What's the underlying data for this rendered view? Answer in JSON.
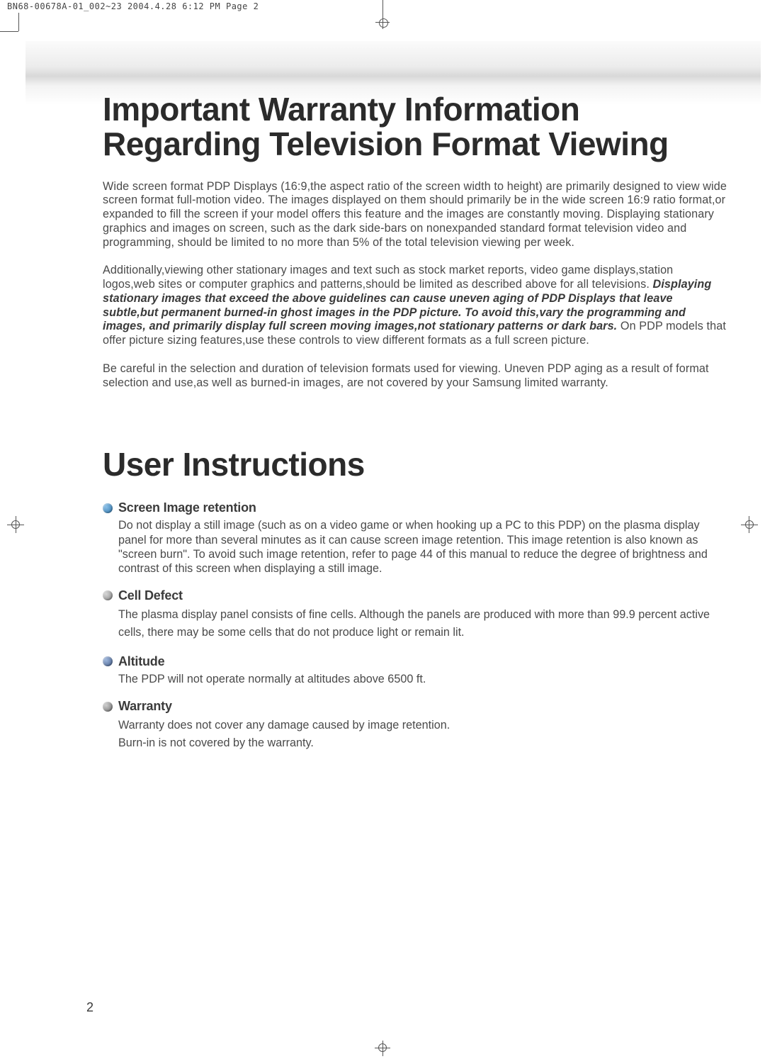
{
  "print_header": "BN68-00678A-01_002~23  2004.4.28  6:12 PM  Page 2",
  "title1": "Important Warranty Information Regarding Television Format Viewing",
  "para1": "Wide screen format PDP Displays (16:9,the aspect ratio of the screen width to height) are primarily designed to view wide screen format full-motion video. The images displayed on them should primarily be in the wide screen 16:9 ratio format,or expanded to fill the screen if your model offers this feature and the images are constantly moving. Displaying stationary graphics and images on screen, such as the dark side-bars on nonexpanded standard format television video and programming, should be limited to no more than 5% of the total television viewing per week.",
  "para2a": "Additionally,viewing other stationary images and text such as stock market reports, video game displays,station logos,web sites or computer graphics and patterns,should be limited as described above for all televisions. ",
  "para2b_bold": "Displaying stationary images that exceed the above guidelines can cause uneven aging of PDP Displays that leave subtle,but permanent burned-in ghost images in the PDP picture. To avoid this,vary the programming and images, and primarily display full screen moving images,not stationary patterns or dark bars.",
  "para2c": " On PDP models that offer picture sizing features,use these controls to view different formats as a full screen picture.",
  "para3": "Be careful in the selection and duration of television formats used for viewing. Uneven PDP aging as a result of format selection and use,as well as burned-in images, are not covered by your Samsung limited warranty.",
  "title2": "User Instructions",
  "sections": [
    {
      "title": "Screen Image retention",
      "body": "Do not display a still image (such as on a video game or when hooking up a PC to this PDP) on the plasma display panel for more than several minutes as  it can cause screen image retention. This image retention is also known as \"screen burn\". To avoid such image retention, refer to page 44 of this manual to reduce the degree of brightness and contrast of this screen when displaying a still image."
    },
    {
      "title": "Cell Defect",
      "body": "The plasma display panel consists of fine cells. Although the panels are produced with more than 99.9 percent active cells, there may be some cells that do not produce light or remain lit."
    },
    {
      "title": "Altitude",
      "body": "The PDP will not operate normally at altitudes above 6500 ft."
    },
    {
      "title": "Warranty",
      "body": "Warranty does not cover any damage caused by image retention.\nBurn-in is not covered by the warranty."
    }
  ],
  "page_number": "2"
}
